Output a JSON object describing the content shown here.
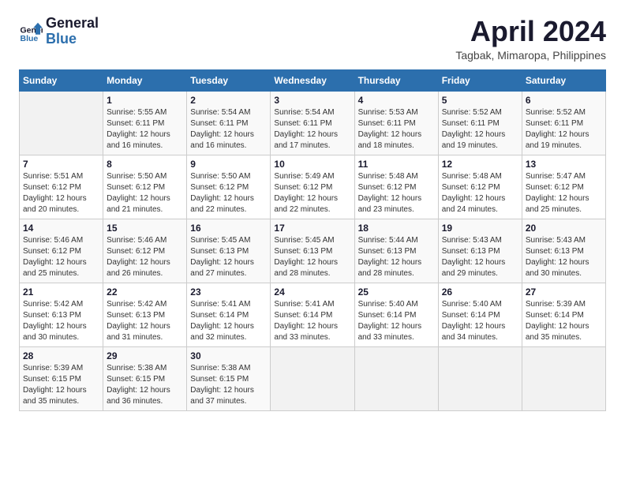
{
  "header": {
    "logo_line1": "General",
    "logo_line2": "Blue",
    "month": "April 2024",
    "location": "Tagbak, Mimaropa, Philippines"
  },
  "calendar": {
    "days_of_week": [
      "Sunday",
      "Monday",
      "Tuesday",
      "Wednesday",
      "Thursday",
      "Friday",
      "Saturday"
    ],
    "weeks": [
      [
        {
          "day": "",
          "sunrise": "",
          "sunset": "",
          "daylight": "",
          "empty": true
        },
        {
          "day": "1",
          "sunrise": "Sunrise: 5:55 AM",
          "sunset": "Sunset: 6:11 PM",
          "daylight": "Daylight: 12 hours and 16 minutes.",
          "empty": false
        },
        {
          "day": "2",
          "sunrise": "Sunrise: 5:54 AM",
          "sunset": "Sunset: 6:11 PM",
          "daylight": "Daylight: 12 hours and 16 minutes.",
          "empty": false
        },
        {
          "day": "3",
          "sunrise": "Sunrise: 5:54 AM",
          "sunset": "Sunset: 6:11 PM",
          "daylight": "Daylight: 12 hours and 17 minutes.",
          "empty": false
        },
        {
          "day": "4",
          "sunrise": "Sunrise: 5:53 AM",
          "sunset": "Sunset: 6:11 PM",
          "daylight": "Daylight: 12 hours and 18 minutes.",
          "empty": false
        },
        {
          "day": "5",
          "sunrise": "Sunrise: 5:52 AM",
          "sunset": "Sunset: 6:11 PM",
          "daylight": "Daylight: 12 hours and 19 minutes.",
          "empty": false
        },
        {
          "day": "6",
          "sunrise": "Sunrise: 5:52 AM",
          "sunset": "Sunset: 6:11 PM",
          "daylight": "Daylight: 12 hours and 19 minutes.",
          "empty": false
        }
      ],
      [
        {
          "day": "7",
          "sunrise": "Sunrise: 5:51 AM",
          "sunset": "Sunset: 6:12 PM",
          "daylight": "Daylight: 12 hours and 20 minutes.",
          "empty": false
        },
        {
          "day": "8",
          "sunrise": "Sunrise: 5:50 AM",
          "sunset": "Sunset: 6:12 PM",
          "daylight": "Daylight: 12 hours and 21 minutes.",
          "empty": false
        },
        {
          "day": "9",
          "sunrise": "Sunrise: 5:50 AM",
          "sunset": "Sunset: 6:12 PM",
          "daylight": "Daylight: 12 hours and 22 minutes.",
          "empty": false
        },
        {
          "day": "10",
          "sunrise": "Sunrise: 5:49 AM",
          "sunset": "Sunset: 6:12 PM",
          "daylight": "Daylight: 12 hours and 22 minutes.",
          "empty": false
        },
        {
          "day": "11",
          "sunrise": "Sunrise: 5:48 AM",
          "sunset": "Sunset: 6:12 PM",
          "daylight": "Daylight: 12 hours and 23 minutes.",
          "empty": false
        },
        {
          "day": "12",
          "sunrise": "Sunrise: 5:48 AM",
          "sunset": "Sunset: 6:12 PM",
          "daylight": "Daylight: 12 hours and 24 minutes.",
          "empty": false
        },
        {
          "day": "13",
          "sunrise": "Sunrise: 5:47 AM",
          "sunset": "Sunset: 6:12 PM",
          "daylight": "Daylight: 12 hours and 25 minutes.",
          "empty": false
        }
      ],
      [
        {
          "day": "14",
          "sunrise": "Sunrise: 5:46 AM",
          "sunset": "Sunset: 6:12 PM",
          "daylight": "Daylight: 12 hours and 25 minutes.",
          "empty": false
        },
        {
          "day": "15",
          "sunrise": "Sunrise: 5:46 AM",
          "sunset": "Sunset: 6:12 PM",
          "daylight": "Daylight: 12 hours and 26 minutes.",
          "empty": false
        },
        {
          "day": "16",
          "sunrise": "Sunrise: 5:45 AM",
          "sunset": "Sunset: 6:13 PM",
          "daylight": "Daylight: 12 hours and 27 minutes.",
          "empty": false
        },
        {
          "day": "17",
          "sunrise": "Sunrise: 5:45 AM",
          "sunset": "Sunset: 6:13 PM",
          "daylight": "Daylight: 12 hours and 28 minutes.",
          "empty": false
        },
        {
          "day": "18",
          "sunrise": "Sunrise: 5:44 AM",
          "sunset": "Sunset: 6:13 PM",
          "daylight": "Daylight: 12 hours and 28 minutes.",
          "empty": false
        },
        {
          "day": "19",
          "sunrise": "Sunrise: 5:43 AM",
          "sunset": "Sunset: 6:13 PM",
          "daylight": "Daylight: 12 hours and 29 minutes.",
          "empty": false
        },
        {
          "day": "20",
          "sunrise": "Sunrise: 5:43 AM",
          "sunset": "Sunset: 6:13 PM",
          "daylight": "Daylight: 12 hours and 30 minutes.",
          "empty": false
        }
      ],
      [
        {
          "day": "21",
          "sunrise": "Sunrise: 5:42 AM",
          "sunset": "Sunset: 6:13 PM",
          "daylight": "Daylight: 12 hours and 30 minutes.",
          "empty": false
        },
        {
          "day": "22",
          "sunrise": "Sunrise: 5:42 AM",
          "sunset": "Sunset: 6:13 PM",
          "daylight": "Daylight: 12 hours and 31 minutes.",
          "empty": false
        },
        {
          "day": "23",
          "sunrise": "Sunrise: 5:41 AM",
          "sunset": "Sunset: 6:14 PM",
          "daylight": "Daylight: 12 hours and 32 minutes.",
          "empty": false
        },
        {
          "day": "24",
          "sunrise": "Sunrise: 5:41 AM",
          "sunset": "Sunset: 6:14 PM",
          "daylight": "Daylight: 12 hours and 33 minutes.",
          "empty": false
        },
        {
          "day": "25",
          "sunrise": "Sunrise: 5:40 AM",
          "sunset": "Sunset: 6:14 PM",
          "daylight": "Daylight: 12 hours and 33 minutes.",
          "empty": false
        },
        {
          "day": "26",
          "sunrise": "Sunrise: 5:40 AM",
          "sunset": "Sunset: 6:14 PM",
          "daylight": "Daylight: 12 hours and 34 minutes.",
          "empty": false
        },
        {
          "day": "27",
          "sunrise": "Sunrise: 5:39 AM",
          "sunset": "Sunset: 6:14 PM",
          "daylight": "Daylight: 12 hours and 35 minutes.",
          "empty": false
        }
      ],
      [
        {
          "day": "28",
          "sunrise": "Sunrise: 5:39 AM",
          "sunset": "Sunset: 6:15 PM",
          "daylight": "Daylight: 12 hours and 35 minutes.",
          "empty": false
        },
        {
          "day": "29",
          "sunrise": "Sunrise: 5:38 AM",
          "sunset": "Sunset: 6:15 PM",
          "daylight": "Daylight: 12 hours and 36 minutes.",
          "empty": false
        },
        {
          "day": "30",
          "sunrise": "Sunrise: 5:38 AM",
          "sunset": "Sunset: 6:15 PM",
          "daylight": "Daylight: 12 hours and 37 minutes.",
          "empty": false
        },
        {
          "day": "",
          "sunrise": "",
          "sunset": "",
          "daylight": "",
          "empty": true
        },
        {
          "day": "",
          "sunrise": "",
          "sunset": "",
          "daylight": "",
          "empty": true
        },
        {
          "day": "",
          "sunrise": "",
          "sunset": "",
          "daylight": "",
          "empty": true
        },
        {
          "day": "",
          "sunrise": "",
          "sunset": "",
          "daylight": "",
          "empty": true
        }
      ]
    ]
  }
}
